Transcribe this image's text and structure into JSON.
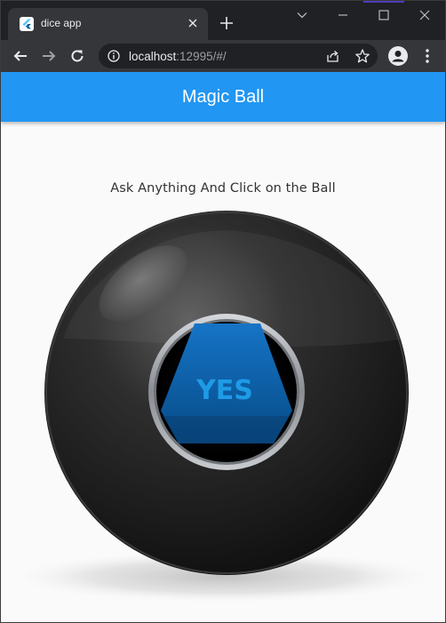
{
  "browser": {
    "tab": {
      "title": "dice app",
      "favicon": "flutter-icon"
    },
    "new_tab_label": "+",
    "url": {
      "host": "localhost",
      "rest": ":12995/#/"
    },
    "icons": {
      "back": "back-arrow-icon",
      "forward": "forward-arrow-icon",
      "reload": "reload-icon",
      "info": "info-icon",
      "share": "share-icon",
      "bookmark": "star-icon",
      "profile": "profile-icon",
      "menu": "kebab-menu-icon",
      "minimize": "minimize-icon",
      "maximize": "maximize-icon",
      "close": "close-icon"
    }
  },
  "app": {
    "title": "Magic Ball",
    "prompt": "Ask Anything And Click on the Ball",
    "answer": "YES",
    "colors": {
      "appbar": "#2196f3",
      "background": "#fafafa",
      "ball": "#1f1f1f",
      "answer_triangle": "#0a5fa6",
      "answer_text": "#1e9be6"
    }
  }
}
